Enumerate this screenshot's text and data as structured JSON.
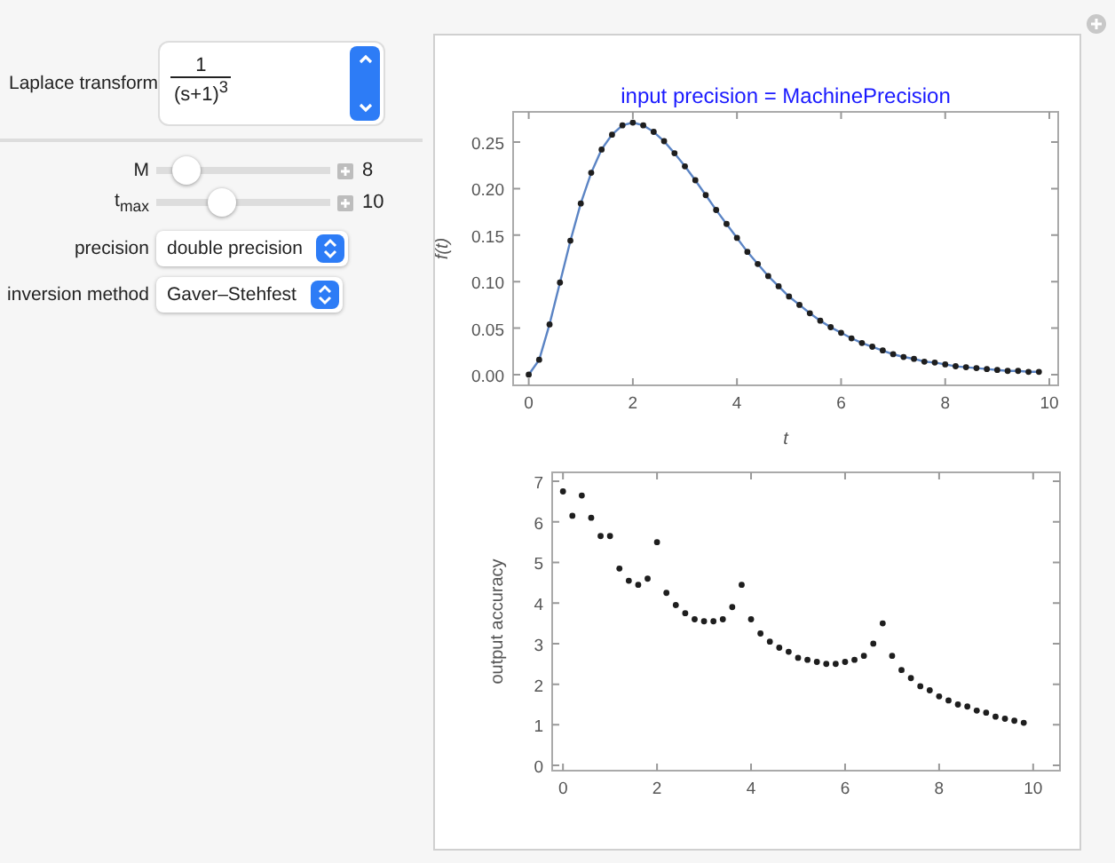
{
  "controls": {
    "laplace": {
      "label": "Laplace transform",
      "numerator": "1",
      "denominator": "(s+1)$^{3}$"
    },
    "sliders": [
      {
        "label": "M",
        "level": 0.17,
        "reading": "8"
      },
      {
        "label": "t$_{max}$",
        "level": 0.38,
        "reading": "10"
      }
    ],
    "dropdowns": [
      {
        "label": "precision",
        "value": "double precision"
      },
      {
        "label": "inversion method",
        "value": "Gaver–Stehfest"
      }
    ]
  },
  "plots": [
    {
      "chart_data": {
        "type": "line",
        "title": "input precision = MachinePrecision",
        "xlabel": "t",
        "ylabel": "f(t)",
        "x": [
          0,
          0.2,
          0.4,
          0.6,
          0.8,
          1,
          1.2,
          1.4,
          1.6,
          1.8,
          2,
          2.2,
          2.4,
          2.6,
          2.8,
          3,
          3.2,
          3.4,
          3.6,
          3.8,
          4,
          4.2,
          4.4,
          4.6,
          4.8,
          5,
          5.2,
          5.4,
          5.6,
          5.8,
          6,
          6.2,
          6.4,
          6.6,
          6.8,
          7,
          7.2,
          7.4,
          7.6,
          7.8,
          8,
          8.2,
          8.4,
          8.6,
          8.8,
          9,
          9.2,
          9.4,
          9.6,
          9.8
        ],
        "xlim": [
          -0.3,
          10.17
        ],
        "ylim": [
          -0.0115,
          0.2825
        ],
        "xticks": [
          0,
          2,
          4,
          6,
          8,
          10
        ],
        "yticks": [
          {
            "value": 0,
            "label": "0.00"
          },
          {
            "value": 0.05,
            "label": "0.05"
          },
          {
            "value": 0.1,
            "label": "0.10"
          },
          {
            "value": 0.15,
            "label": "0.15"
          },
          {
            "value": 0.2,
            "label": "0.20"
          },
          {
            "value": 0.25,
            "label": "0.25"
          }
        ],
        "series": [
          {
            "color": "#5b84c4",
            "marker": true,
            "values": [
              0,
              0.016,
              0.054,
              0.099,
              0.144,
              0.184,
              0.217,
              0.242,
              0.258,
              0.268,
              0.271,
              0.268,
              0.261,
              0.251,
              0.238,
              0.224,
              0.209,
              0.193,
              0.177,
              0.162,
              0.147,
              0.132,
              0.119,
              0.106,
              0.095,
              0.084,
              0.075,
              0.066,
              0.058,
              0.051,
              0.045,
              0.039,
              0.034,
              0.03,
              0.026,
              0.022,
              0.019,
              0.017,
              0.014,
              0.013,
              0.011,
              0.009,
              0.008,
              0.007,
              0.006,
              0.005,
              0.004,
              0.004,
              0.003,
              0.003
            ]
          }
        ]
      }
    },
    {
      "chart_data": {
        "type": "scatter",
        "ylabel": "output accuracy",
        "x": [
          0,
          0.2,
          0.4,
          0.6,
          0.8,
          1,
          1.2,
          1.4,
          1.6,
          1.8,
          2,
          2.2,
          2.4,
          2.6,
          2.8,
          3,
          3.2,
          3.4,
          3.6,
          3.8,
          4,
          4.2,
          4.4,
          4.6,
          4.8,
          5,
          5.2,
          5.4,
          5.6,
          5.8,
          6,
          6.2,
          6.4,
          6.6,
          6.8,
          7,
          7.2,
          7.4,
          7.6,
          7.8,
          8,
          8.2,
          8.4,
          8.6,
          8.8,
          9,
          9.2,
          9.4,
          9.6,
          9.8
        ],
        "xlim": [
          -0.23,
          10.57
        ],
        "ylim": [
          -0.13,
          7.22
        ],
        "xticks": [
          0,
          2,
          4,
          6,
          8,
          10
        ],
        "yticks": [
          0,
          1,
          2,
          3,
          4,
          5,
          6,
          7
        ],
        "series": [
          {
            "color": "#1e1e1e",
            "values": [
              6.75,
              6.15,
              6.65,
              6.1,
              5.65,
              5.65,
              4.85,
              4.55,
              4.45,
              4.6,
              5.5,
              4.25,
              3.95,
              3.75,
              3.6,
              3.55,
              3.55,
              3.6,
              3.9,
              4.45,
              3.6,
              3.25,
              3.05,
              2.9,
              2.8,
              2.65,
              2.6,
              2.55,
              2.5,
              2.5,
              2.55,
              2.6,
              2.7,
              3.0,
              3.5,
              2.7,
              2.35,
              2.15,
              1.95,
              1.85,
              1.7,
              1.6,
              1.5,
              1.45,
              1.35,
              1.3,
              1.2,
              1.15,
              1.1,
              1.05
            ]
          }
        ]
      }
    }
  ]
}
